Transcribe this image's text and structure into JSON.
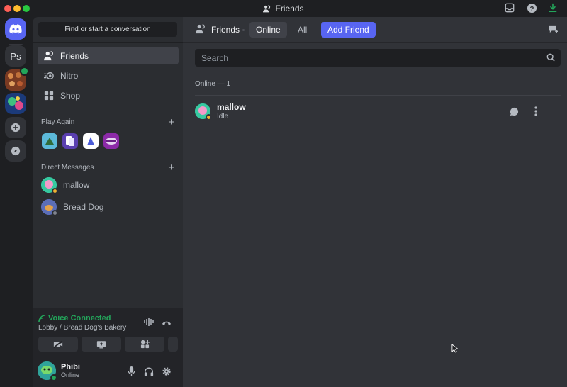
{
  "window": {
    "title": "Friends"
  },
  "rail": {
    "user_server_initials": "Ps"
  },
  "sidebar": {
    "find_placeholder": "Find or start a conversation",
    "nav": [
      {
        "label": "Friends",
        "icon": "friends-icon",
        "active": true
      },
      {
        "label": "Nitro",
        "icon": "nitro-icon",
        "active": false
      },
      {
        "label": "Shop",
        "icon": "shop-icon",
        "active": false
      }
    ],
    "play_again": {
      "title": "Play Again",
      "add_icon": "plus-icon"
    },
    "direct_messages": {
      "title": "Direct Messages",
      "items": [
        {
          "name": "mallow",
          "status": "idle"
        },
        {
          "name": "Bread Dog",
          "status": "offline"
        }
      ]
    }
  },
  "voice": {
    "status": "Voice Connected",
    "channel": "Lobby / Bread Dog's Bakery"
  },
  "user": {
    "name": "Phibi",
    "status": "Online"
  },
  "main": {
    "header": {
      "title": "Friends"
    },
    "tabs": [
      {
        "label": "Online",
        "selected": true
      },
      {
        "label": "All",
        "selected": false
      }
    ],
    "add_friend_label": "Add Friend",
    "search_placeholder": "Search",
    "online_count": "Online — 1",
    "friends": [
      {
        "name": "mallow",
        "status_text": "Idle",
        "status": "idle"
      }
    ]
  },
  "colors": {
    "accent": "#5865f2",
    "online": "#23a55a",
    "idle": "#f0b232",
    "offline": "#80848e"
  }
}
